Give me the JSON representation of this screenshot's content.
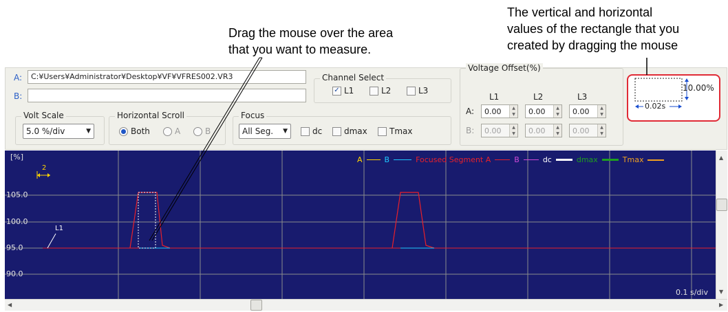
{
  "callouts": {
    "drag": "Drag the mouse over the area\nthat you want to measure.",
    "rect": "The vertical and horizontal\nvalues of the rectangle that you\ncreated by dragging the mouse"
  },
  "files": {
    "a_label": "A:",
    "a_value": "C:¥Users¥Administrator¥Desktop¥VF¥VFRES002.VR3",
    "b_label": "B:",
    "b_value": ""
  },
  "channel_select": {
    "title": "Channel Select",
    "items": [
      {
        "label": "L1",
        "checked": "✓"
      },
      {
        "label": "L2",
        "checked": ""
      },
      {
        "label": "L3",
        "checked": ""
      }
    ]
  },
  "voltage_offset": {
    "title": "Voltage Offset(%)",
    "cols": [
      "L1",
      "L2",
      "L3"
    ],
    "row_a_label": "A:",
    "row_b_label": "B:",
    "row_a": [
      "0.00",
      "0.00",
      "0.00"
    ],
    "row_b": [
      "0.00",
      "0.00",
      "0.00"
    ]
  },
  "volt_scale": {
    "title": "Volt Scale",
    "value": "5.0 %/div"
  },
  "horizontal_scroll": {
    "title": "Horizontal Scroll",
    "options": [
      "Both",
      "A",
      "B"
    ],
    "selected": "Both"
  },
  "focus": {
    "title": "Focus",
    "select_value": "All Seg.",
    "checks": [
      "dc",
      "dmax",
      "Tmax"
    ]
  },
  "measure": {
    "vertical": "10.00%",
    "horizontal": "0.02s"
  },
  "graph": {
    "unit_label": "[%]",
    "cursor_label": "2",
    "y_ticks": [
      "105.0",
      "100.0",
      "95.0",
      "90.0"
    ],
    "x_scale": "0.1 s/div",
    "channel_label": "L1",
    "legend": [
      {
        "label": "A",
        "color": "#ffd400"
      },
      {
        "label": "B",
        "color": "#1ec8ff"
      },
      {
        "label": "Focused Segment A",
        "color": "#e8202a"
      },
      {
        "label": "B",
        "color": "#d04ad8"
      },
      {
        "label": "dc",
        "color": "#ffffff"
      },
      {
        "label": "dmax",
        "color": "#1ea01e"
      },
      {
        "label": "Tmax",
        "color": "#f0a020"
      }
    ]
  }
}
